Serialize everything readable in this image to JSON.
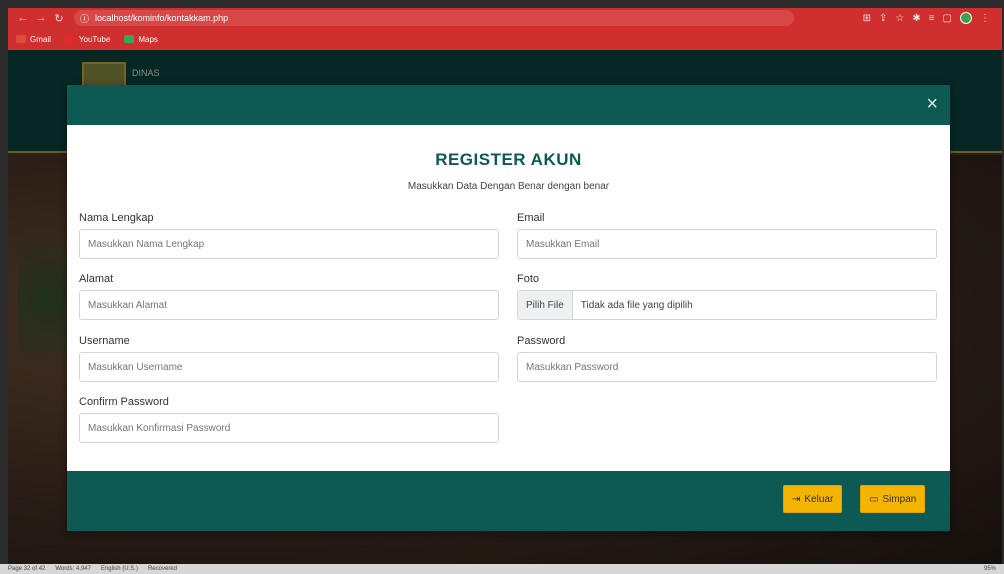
{
  "browser": {
    "address": "localhost/kominfo/kontakkam.php",
    "bookmarks": [
      {
        "label": "Gmail",
        "color": "#e04b3a"
      },
      {
        "label": "YouTube",
        "color": "#e02b2b"
      },
      {
        "label": "Maps",
        "color": "#34a853"
      }
    ]
  },
  "background": {
    "logo_text": "DINAS"
  },
  "modal": {
    "close_glyph": "×",
    "title": "REGISTER AKUN",
    "subtitle": "Masukkan Data Dengan Benar dengan benar",
    "fields": {
      "nama": {
        "label": "Nama Lengkap",
        "placeholder": "Masukkan Nama Lengkap"
      },
      "email": {
        "label": "Email",
        "placeholder": "Masukkan Email"
      },
      "alamat": {
        "label": "Alamat",
        "placeholder": "Masukkan Alamat"
      },
      "foto": {
        "label": "Foto",
        "button": "Pilih File",
        "status": "Tidak ada file yang dipilih"
      },
      "username": {
        "label": "Username",
        "placeholder": "Masukkan Username"
      },
      "password": {
        "label": "Password",
        "placeholder": "Masukkan Password"
      },
      "confirm": {
        "label": "Confirm Password",
        "placeholder": "Masukkan Konfirmasi Password"
      }
    },
    "buttons": {
      "keluar": "Keluar",
      "simpan": "Simpan"
    }
  },
  "statusbar": {
    "page": "Page 32 of 42",
    "words": "Words: 4,947",
    "lang": "English (U.S.)",
    "state": "Recovered",
    "zoom": "95%"
  },
  "colors": {
    "teal": "#0d5a55",
    "accent": "#f5b400",
    "chrome": "#cf2f2f"
  }
}
